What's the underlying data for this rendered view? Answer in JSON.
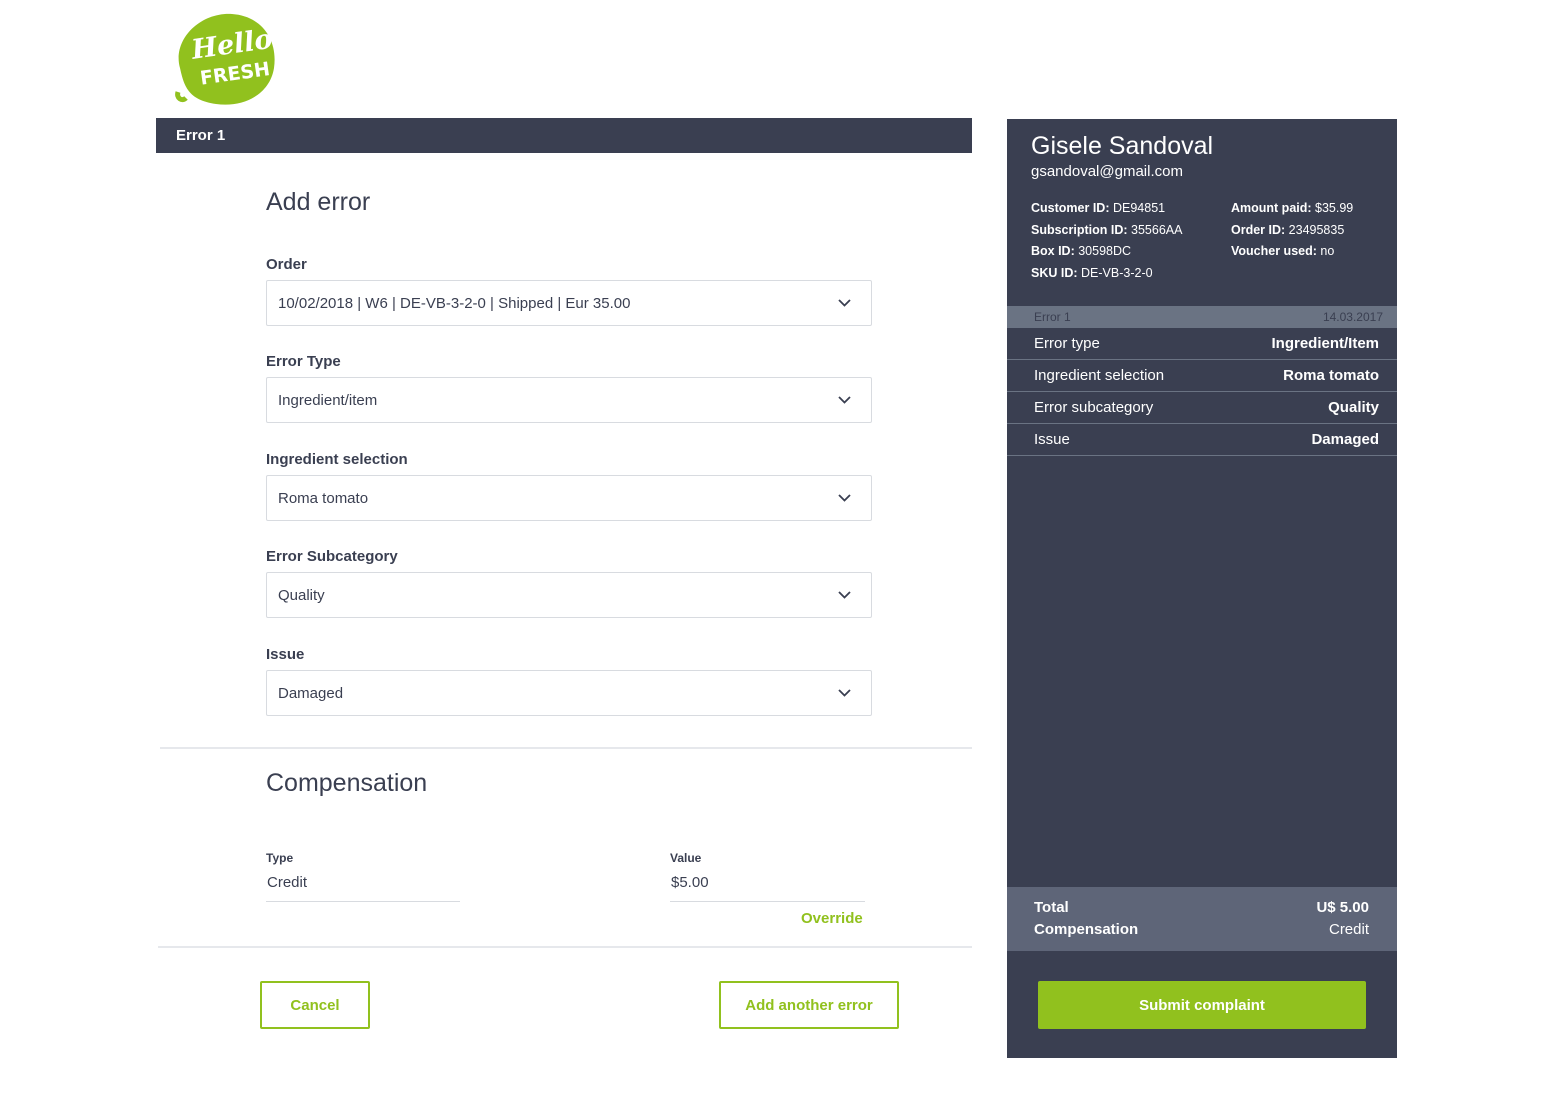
{
  "brand": {
    "logo_line1": "Hello",
    "logo_line2": "FRESH",
    "green": "#91c11e",
    "navy": "#3a3f51"
  },
  "tab": {
    "label": "Error 1"
  },
  "form": {
    "title": "Add error",
    "fields": [
      {
        "label": "Order",
        "value": "10/02/2018 | W6 | DE-VB-3-2-0 |  Shipped | Eur 35.00"
      },
      {
        "label": "Error Type",
        "value": "Ingredient/item"
      },
      {
        "label": "Ingredient selection",
        "value": "Roma tomato"
      },
      {
        "label": "Error Subcategory",
        "value": "Quality"
      },
      {
        "label": "Issue",
        "value": "Damaged"
      }
    ]
  },
  "compensation": {
    "title": "Compensation",
    "type_label": "Type",
    "type_value": "Credit",
    "value_label": "Value",
    "value_value": "$5.00",
    "override": "Override"
  },
  "actions": {
    "cancel": "Cancel",
    "add_another": "Add another error"
  },
  "customer": {
    "name": "Gisele Sandoval",
    "email": "gsandoval@gmail.com",
    "customer_id_label": "Customer ID:",
    "customer_id": "DE94851",
    "subscription_id_label": "Subscription ID:",
    "subscription_id": "35566AA",
    "box_id_label": "Box ID:",
    "box_id": "30598DC",
    "sku_id_label": "SKU ID:",
    "sku_id": "DE-VB-3-2-0",
    "amount_paid_label": "Amount paid:",
    "amount_paid": "$35.99",
    "order_id_label": "Order ID:",
    "order_id": "23495835",
    "voucher_label": "Voucher used:",
    "voucher": "no"
  },
  "summary": {
    "error_label": "Error 1",
    "date": "14.03.2017",
    "rows": [
      {
        "key": "Error type",
        "value": "Ingredient/Item"
      },
      {
        "key": "Ingredient selection",
        "value": "Roma tomato"
      },
      {
        "key": "Error subcategory",
        "value": "Quality"
      },
      {
        "key": "Issue",
        "value": "Damaged"
      }
    ],
    "total_label_1": "Total",
    "total_label_2": "Compensation",
    "total_amount": "U$ 5.00",
    "total_type": "Credit",
    "submit": "Submit complaint"
  }
}
